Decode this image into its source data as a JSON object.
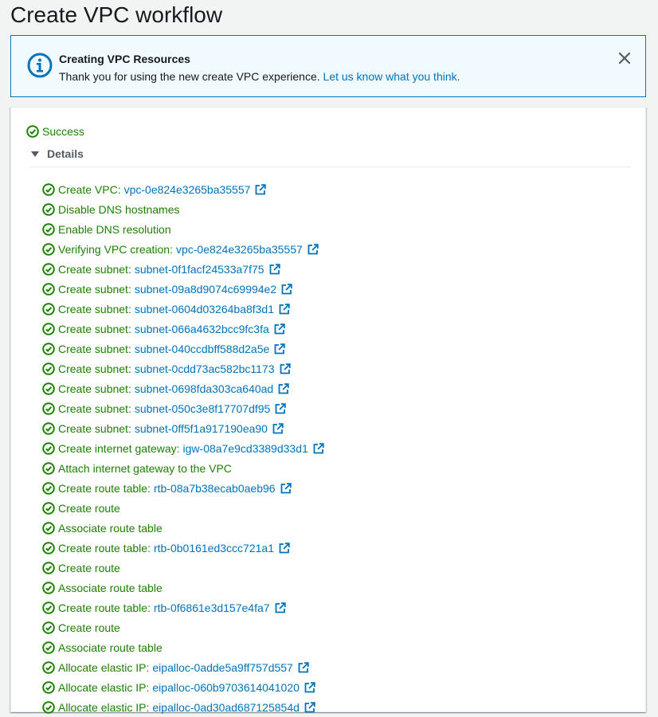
{
  "page": {
    "title": "Create VPC workflow"
  },
  "flash": {
    "title": "Creating VPC Resources",
    "message": "Thank you for using the new create VPC experience.",
    "link_text": "Let us know what you think."
  },
  "status": {
    "text": "Success"
  },
  "details": {
    "label": "Details",
    "expanded": true
  },
  "colors": {
    "success": "#1d8102",
    "link": "#0073bb",
    "info_border": "#0073bb",
    "info_background": "#f1faff"
  },
  "steps": [
    {
      "text": "Create VPC:",
      "link": "vpc-0e824e3265ba35557"
    },
    {
      "text": "Disable DNS hostnames",
      "link": null
    },
    {
      "text": "Enable DNS resolution",
      "link": null
    },
    {
      "text": "Verifying VPC creation:",
      "link": "vpc-0e824e3265ba35557"
    },
    {
      "text": "Create subnet:",
      "link": "subnet-0f1facf24533a7f75"
    },
    {
      "text": "Create subnet:",
      "link": "subnet-09a8d9074c69994e2"
    },
    {
      "text": "Create subnet:",
      "link": "subnet-0604d03264ba8f3d1"
    },
    {
      "text": "Create subnet:",
      "link": "subnet-066a4632bcc9fc3fa"
    },
    {
      "text": "Create subnet:",
      "link": "subnet-040ccdbff588d2a5e"
    },
    {
      "text": "Create subnet:",
      "link": "subnet-0cdd73ac582bc1173"
    },
    {
      "text": "Create subnet:",
      "link": "subnet-0698fda303ca640ad"
    },
    {
      "text": "Create subnet:",
      "link": "subnet-050c3e8f17707df95"
    },
    {
      "text": "Create subnet:",
      "link": "subnet-0ff5f1a917190ea90"
    },
    {
      "text": "Create internet gateway:",
      "link": "igw-08a7e9cd3389d33d1"
    },
    {
      "text": "Attach internet gateway to the VPC",
      "link": null
    },
    {
      "text": "Create route table:",
      "link": "rtb-08a7b38ecab0aeb96"
    },
    {
      "text": "Create route",
      "link": null
    },
    {
      "text": "Associate route table",
      "link": null
    },
    {
      "text": "Create route table:",
      "link": "rtb-0b0161ed3ccc721a1"
    },
    {
      "text": "Create route",
      "link": null
    },
    {
      "text": "Associate route table",
      "link": null
    },
    {
      "text": "Create route table:",
      "link": "rtb-0f6861e3d157e4fa7"
    },
    {
      "text": "Create route",
      "link": null
    },
    {
      "text": "Associate route table",
      "link": null
    },
    {
      "text": "Allocate elastic IP:",
      "link": "eipalloc-0adde5a9ff757d557"
    },
    {
      "text": "Allocate elastic IP:",
      "link": "eipalloc-060b9703614041020"
    },
    {
      "text": "Allocate elastic IP:",
      "link": "eipalloc-0ad30ad687125854d"
    }
  ]
}
